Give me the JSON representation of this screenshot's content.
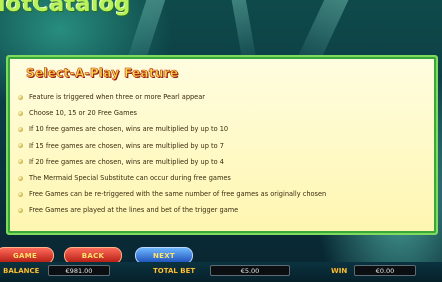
{
  "header": {
    "logo_text": "lotCatalog"
  },
  "panel": {
    "title": "Select-A-Play Feature",
    "rules": [
      "Feature is triggered when three or more Pearl appear",
      "Choose 10, 15 or 20 Free Games",
      "If 10 free games are chosen, wins are multiplied by up to 10",
      "If 15 free games are chosen, wins are multiplied by up to 7",
      "If 20 free games are chosen, wins are multiplied by up to 4",
      "The Mermaid Special Substitute can occur during free games",
      "Free Games can be re-triggered with the same number of free games as originally chosen",
      "Free Games are played at the lines and bet of the trigger game"
    ]
  },
  "controls": {
    "game_label": "GAME",
    "back_label": "BACK",
    "next_label": "NEXT"
  },
  "footer": {
    "balance_label": "BALANCE",
    "balance_value": "€981.00",
    "total_bet_label": "TOTAL BET",
    "total_bet_value": "€5.00",
    "win_label": "WIN",
    "win_value": "€0.00"
  },
  "colors": {
    "panel_border": "#7fdb5d",
    "title_fill": "#f7e04a",
    "label_yellow": "#ffe34a"
  }
}
